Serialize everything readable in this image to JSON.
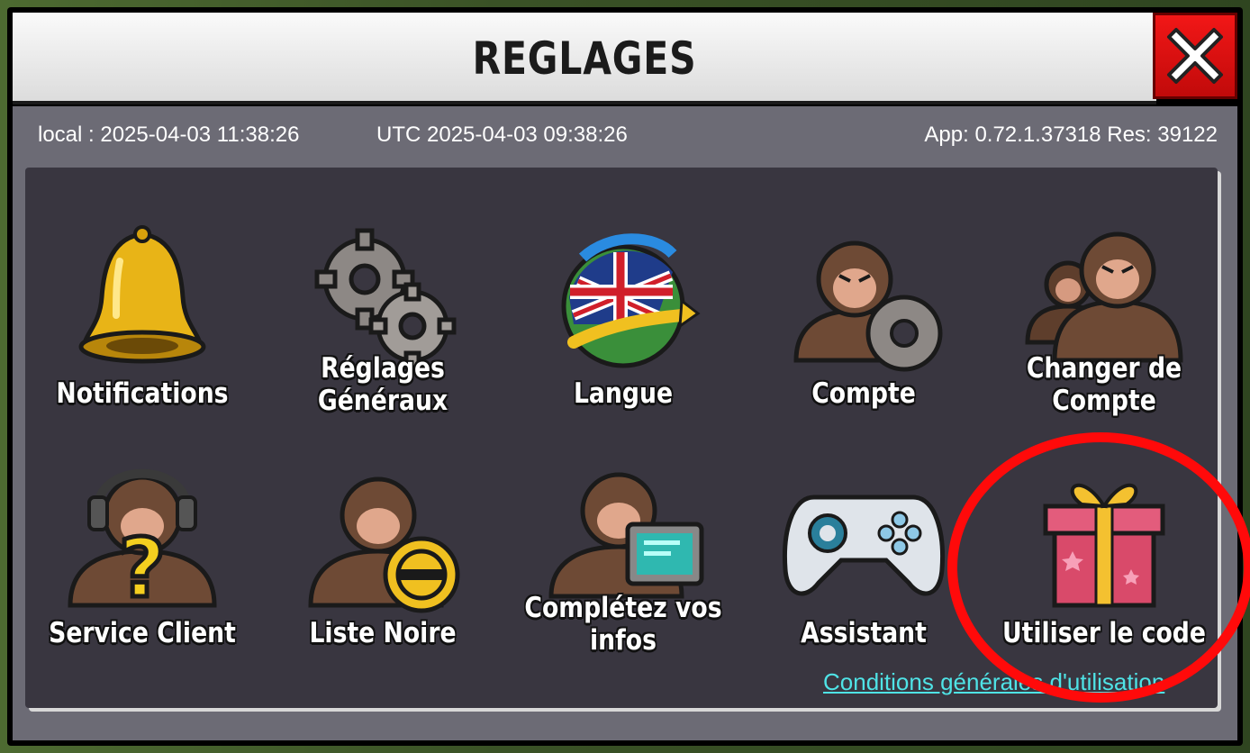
{
  "dialog": {
    "title": "REGLAGES",
    "close_icon": "close-x-icon"
  },
  "info": {
    "local": "local : 2025-04-03 11:38:26",
    "utc": "UTC 2025-04-03 09:38:26",
    "app": "App: 0.72.1.37318 Res: 39122"
  },
  "settings": [
    {
      "label": "Notifications",
      "icon": "bell-icon"
    },
    {
      "label": "Réglages Généraux",
      "icon": "gears-icon"
    },
    {
      "label": "Langue",
      "icon": "globe-flag-icon"
    },
    {
      "label": "Compte",
      "icon": "monkey-gear-icon"
    },
    {
      "label": "Changer de Compte",
      "icon": "monkeys-icon"
    },
    {
      "label": "Service Client",
      "icon": "monkey-headset-icon"
    },
    {
      "label": "Liste Noire",
      "icon": "monkey-block-icon"
    },
    {
      "label": "Complétez vos infos",
      "icon": "monkey-computer-icon"
    },
    {
      "label": "Assistant",
      "icon": "gamepad-icon"
    },
    {
      "label": "Utiliser le code",
      "icon": "gift-icon"
    }
  ],
  "footer": {
    "tos": "Conditions générales d'utilisation"
  },
  "colors": {
    "title_bar": "#e8e8e8",
    "close_button": "#e21010",
    "panel": "#6c6b75",
    "grid": "#393640",
    "link": "#4fe3e6",
    "highlight": "#ff0a0a"
  }
}
